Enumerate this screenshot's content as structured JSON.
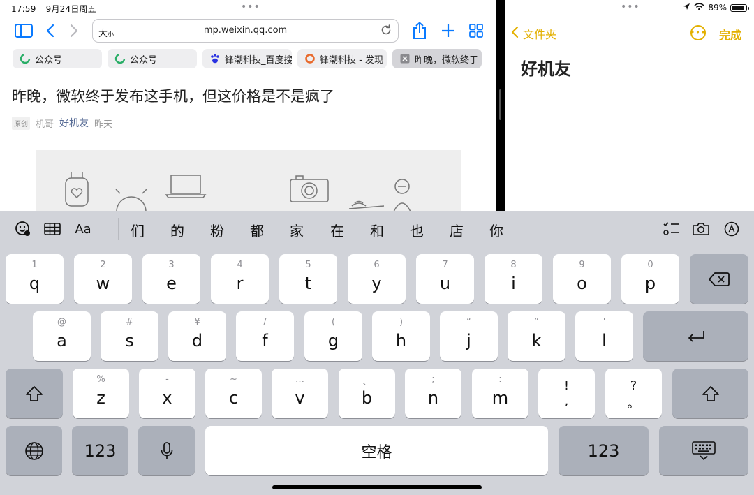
{
  "status_bar": {
    "time": "17:59",
    "date": "9月24日周五",
    "battery": "89%"
  },
  "safari": {
    "text_size_label": "大",
    "text_size_small": "小",
    "url": "mp.weixin.qq.com",
    "tabs": [
      {
        "label": "公众号",
        "icon": "wechat-icon"
      },
      {
        "label": "公众号",
        "icon": "wechat-icon"
      },
      {
        "label": "锋潮科技_百度搜",
        "icon": "baidu-paw-icon"
      },
      {
        "label": "锋潮科技 - 发现",
        "icon": "orange-ring-icon"
      },
      {
        "label": "昨晚，微软终于",
        "icon": "close-tab-icon",
        "active": true
      }
    ],
    "article": {
      "title": "昨晚，微软终于发布这手机，但这价格是不是疯了",
      "original_badge": "原创",
      "author": "机哥",
      "account": "好机友",
      "time": "昨天"
    }
  },
  "notes": {
    "back_label": "文件夹",
    "done_label": "完成",
    "note_title": "好机友"
  },
  "keyboard": {
    "candidates": [
      "们",
      "的",
      "粉",
      "都",
      "家",
      "在",
      "和",
      "也",
      "店",
      "你"
    ],
    "row1": [
      {
        "sub": "1",
        "key": "q"
      },
      {
        "sub": "2",
        "key": "w"
      },
      {
        "sub": "3",
        "key": "e"
      },
      {
        "sub": "4",
        "key": "r"
      },
      {
        "sub": "5",
        "key": "t"
      },
      {
        "sub": "6",
        "key": "y"
      },
      {
        "sub": "7",
        "key": "u"
      },
      {
        "sub": "8",
        "key": "i"
      },
      {
        "sub": "9",
        "key": "o"
      },
      {
        "sub": "0",
        "key": "p"
      }
    ],
    "row2": [
      {
        "sub": "@",
        "key": "a"
      },
      {
        "sub": "#",
        "key": "s"
      },
      {
        "sub": "¥",
        "key": "d"
      },
      {
        "sub": "/",
        "key": "f"
      },
      {
        "sub": "(",
        "key": "g"
      },
      {
        "sub": ")",
        "key": "h"
      },
      {
        "sub": "“",
        "key": "j"
      },
      {
        "sub": "”",
        "key": "k"
      },
      {
        "sub": "'",
        "key": "l"
      }
    ],
    "row3": [
      {
        "sub": "%",
        "key": "z"
      },
      {
        "sub": "-",
        "key": "x"
      },
      {
        "sub": "~",
        "key": "c"
      },
      {
        "sub": "…",
        "key": "v"
      },
      {
        "sub": "、",
        "key": "b"
      },
      {
        "sub": ";",
        "key": "n"
      },
      {
        "sub": ":",
        "key": "m"
      }
    ],
    "punct": [
      {
        "top": "!",
        "bottom": ","
      },
      {
        "top": "?",
        "bottom": "。"
      }
    ],
    "num_label": "123",
    "space_label": "空格"
  }
}
